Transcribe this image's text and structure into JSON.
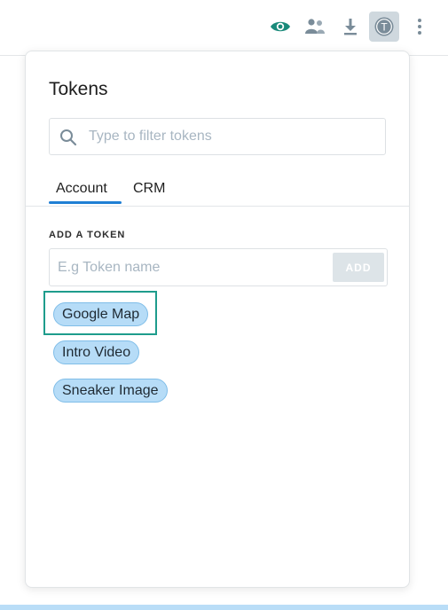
{
  "toolbar": {
    "icons": [
      "eye-icon",
      "users-icon",
      "download-icon",
      "token-icon",
      "more-vertical-icon"
    ],
    "token_icon_letter": "T",
    "colors": {
      "eye": "#1a8a7a",
      "muted": "#7a8c99",
      "active_bg": "#cfd8de"
    }
  },
  "panel": {
    "title": "Tokens",
    "search": {
      "placeholder": "Type to filter tokens",
      "value": ""
    },
    "tabs": [
      {
        "label": "Account",
        "active": true
      },
      {
        "label": "CRM",
        "active": false
      }
    ],
    "add_section": {
      "label": "ADD A TOKEN",
      "input_placeholder": "E.g Token name",
      "input_value": "",
      "button_label": "ADD"
    },
    "tokens": [
      {
        "label": "Google Map",
        "focused": true
      },
      {
        "label": "Intro Video",
        "focused": false
      },
      {
        "label": "Sneaker Image",
        "focused": false
      }
    ]
  },
  "colors": {
    "accent_blue": "#1f7fd4",
    "chip_bg": "#b6dcf7",
    "chip_border": "#7fbde8",
    "focus_ring": "#1e9c8c"
  }
}
